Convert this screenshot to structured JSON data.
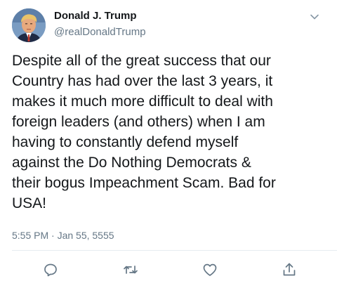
{
  "tweet": {
    "author": {
      "display_name": "Donald J. Trump",
      "handle": "@realDonaldTrump"
    },
    "text": "Despite all of the great success that our\nCountry has had over the last 3 years, it\nmakes it much more difficult to deal with\nforeign leaders (and others) when I am\nhaving to constantly defend myself\nagainst the Do Nothing Democrats &\ntheir bogus Impeachment Scam. Bad for\nUSA!",
    "timestamp": "5:55 PM · Jan 55, 5555"
  },
  "icons": {
    "menu": "chevron-down-icon",
    "reply": "reply-icon",
    "retweet": "retweet-icon",
    "like": "heart-icon",
    "share": "share-icon"
  },
  "colors": {
    "text": "#14171a",
    "secondary": "#657786",
    "divider": "#e6ecf0",
    "icon": "#657786"
  }
}
